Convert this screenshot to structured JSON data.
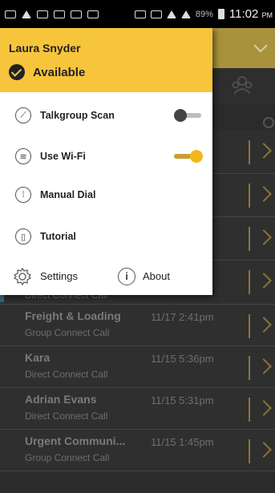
{
  "status_bar": {
    "battery": "89%",
    "time": "11:02",
    "ampm": "PM"
  },
  "drawer": {
    "user_name": "Laura Snyder",
    "presence": "Available",
    "items": [
      {
        "label": "Talkgroup Scan",
        "icon": "scan-icon",
        "toggle": "off"
      },
      {
        "label": "Use Wi-Fi",
        "icon": "wifi-icon",
        "toggle": "on"
      },
      {
        "label": "Manual Dial",
        "icon": "dialpad-icon"
      },
      {
        "label": "Tutorial",
        "icon": "phone-icon"
      }
    ],
    "settings_label": "Settings",
    "about_label": "About"
  },
  "calls": [
    {
      "name": "",
      "time": "",
      "type": "Direct Connect Call"
    },
    {
      "name": "Freight & Loading",
      "time": "11/17 2:41pm",
      "type": "Group Connect Call"
    },
    {
      "name": "Kara",
      "time": "11/15 5:36pm",
      "type": "Direct Connect Call"
    },
    {
      "name": "Adrian Evans",
      "time": "11/15 5:31pm",
      "type": "Direct Connect Call"
    },
    {
      "name": "Urgent Communi...",
      "time": "11/15 1:45pm",
      "type": "Group Connect Call"
    }
  ],
  "partial_times": [
    "m",
    "m",
    "m",
    "m"
  ]
}
